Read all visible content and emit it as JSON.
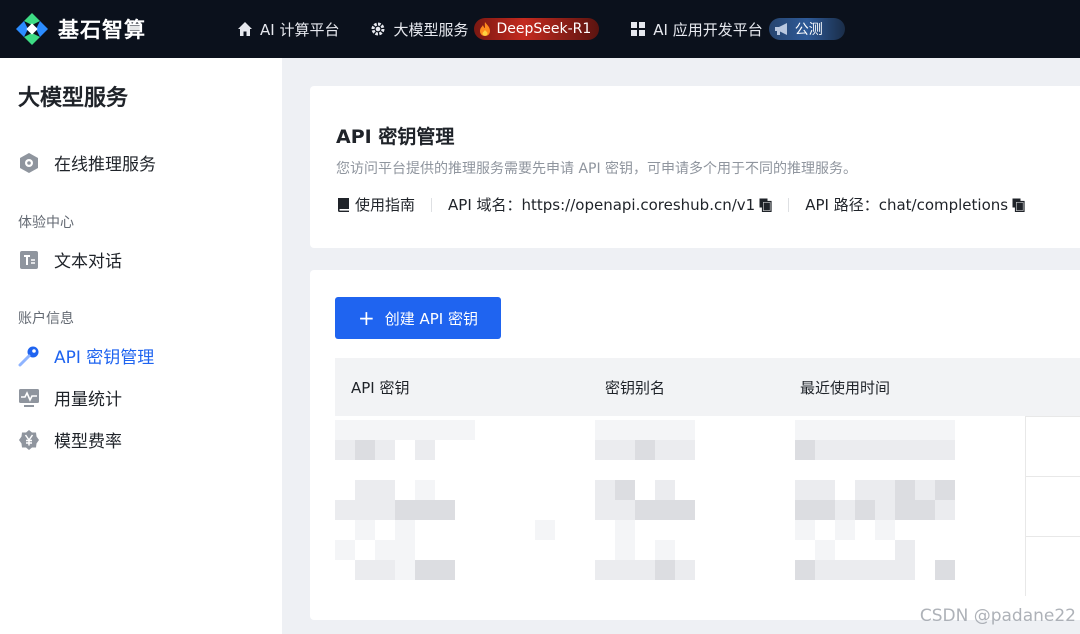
{
  "brand": {
    "name": "基石智算"
  },
  "nav": {
    "items": [
      {
        "label": "AI 计算平台",
        "icon": "home-icon"
      },
      {
        "label": "大模型服务",
        "icon": "gear-icon",
        "badge": "DeepSeek-R1",
        "badge_icon": "fire-icon"
      },
      {
        "label": "AI 应用开发平台",
        "icon": "grid-icon",
        "badge": "公测",
        "badge_icon": "megaphone-icon"
      }
    ]
  },
  "sidebar": {
    "title": "大模型服务",
    "top_item": {
      "label": "在线推理服务",
      "icon": "cube-gear-icon"
    },
    "groups": [
      {
        "title": "体验中心",
        "items": [
          {
            "label": "文本对话",
            "icon": "text-icon"
          }
        ]
      },
      {
        "title": "账户信息",
        "items": [
          {
            "label": "API 密钥管理",
            "icon": "key-icon",
            "active": true
          },
          {
            "label": "用量统计",
            "icon": "chart-icon"
          },
          {
            "label": "模型费率",
            "icon": "yen-icon"
          }
        ]
      }
    ]
  },
  "header_card": {
    "title": "API 密钥管理",
    "description": "您访问平台提供的推理服务需要先申请 API 密钥，可申请多个用于不同的推理服务。",
    "guide_label": "使用指南",
    "domain_label": "API 域名：https://openapi.coreshub.cn/v1",
    "path_label": "API 路径：chat/completions"
  },
  "table": {
    "create_button": "创建 API 密钥",
    "columns": [
      "API 密钥",
      "密钥别名",
      "最近使用时间"
    ]
  },
  "watermark": "CSDN @padane22",
  "colors": {
    "accent": "#1f64f0",
    "topbar": "#0b111c",
    "hot_badge": "#c42a1f",
    "beta_badge": "#2e5a98"
  }
}
